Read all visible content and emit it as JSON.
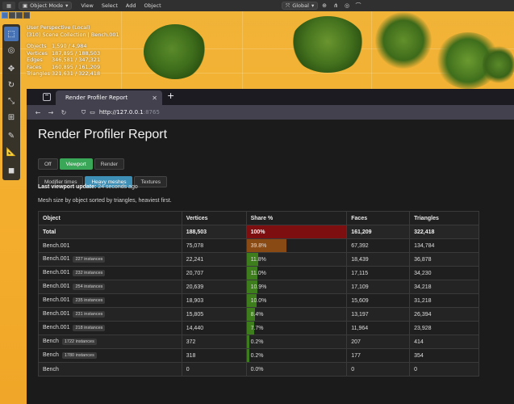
{
  "blender": {
    "mode_label": "Object Mode",
    "menus": [
      "View",
      "Select",
      "Add",
      "Object"
    ],
    "transform_orientation": "Global",
    "overlay": {
      "view_name": "User Perspective (Local)",
      "collection": "(310) Scene Collection | Bench.001",
      "stats": [
        {
          "label": "Objects",
          "value": "1,590 / 4,984"
        },
        {
          "label": "Vertices",
          "value": "187,895 / 188,503"
        },
        {
          "label": "Edges",
          "value": "346,581 / 347,321"
        },
        {
          "label": "Faces",
          "value": "160,895 / 161,209"
        },
        {
          "label": "Triangles",
          "value": "321,631 / 322,418"
        }
      ]
    }
  },
  "browser": {
    "tab_title": "Render Profiler Report",
    "url_host": "http://127.0.0.1",
    "url_rest": ":8765"
  },
  "page": {
    "title": "Render Profiler Report",
    "mode_buttons": [
      "Off",
      "Viewport",
      "Render"
    ],
    "view_buttons": [
      "Modifier times",
      "Heavy meshes",
      "Textures"
    ],
    "last_update_label": "Last viewport update:",
    "last_update_value": "24 seconds ago",
    "description": "Mesh size by object sorted by triangles, heaviest first."
  },
  "table": {
    "headers": [
      "Object",
      "Vertices",
      "Share %",
      "Faces",
      "Triangles"
    ],
    "total": {
      "object": "Total",
      "vertices": "188,503",
      "share": "100%",
      "share_value": 100,
      "faces": "161,209",
      "triangles": "322,418"
    },
    "rows": [
      {
        "object": "Bench.001",
        "badge": "",
        "vertices": "75,078",
        "share": "39.8%",
        "share_value": 39.8,
        "faces": "67,392",
        "triangles": "134,784"
      },
      {
        "object": "Bench.001",
        "badge": "227 instances",
        "vertices": "22,241",
        "share": "11.8%",
        "share_value": 11.8,
        "faces": "18,439",
        "triangles": "36,878"
      },
      {
        "object": "Bench.001",
        "badge": "232 instances",
        "vertices": "20,707",
        "share": "11.0%",
        "share_value": 11.0,
        "faces": "17,115",
        "triangles": "34,230"
      },
      {
        "object": "Bench.001",
        "badge": "254 instances",
        "vertices": "20,639",
        "share": "10.9%",
        "share_value": 10.9,
        "faces": "17,109",
        "triangles": "34,218"
      },
      {
        "object": "Bench.001",
        "badge": "235 instances",
        "vertices": "18,903",
        "share": "10.0%",
        "share_value": 10.0,
        "faces": "15,609",
        "triangles": "31,218"
      },
      {
        "object": "Bench.001",
        "badge": "231 instances",
        "vertices": "15,805",
        "share": "8.4%",
        "share_value": 8.4,
        "faces": "13,197",
        "triangles": "26,394"
      },
      {
        "object": "Bench.001",
        "badge": "218 instances",
        "vertices": "14,440",
        "share": "7.7%",
        "share_value": 7.7,
        "faces": "11,964",
        "triangles": "23,928"
      },
      {
        "object": "Bench",
        "badge": "1722 instances",
        "vertices": "372",
        "share": "0.2%",
        "share_value": 0.2,
        "faces": "207",
        "triangles": "414"
      },
      {
        "object": "Bench",
        "badge": "1780 instances",
        "vertices": "318",
        "share": "0.2%",
        "share_value": 0.2,
        "faces": "177",
        "triangles": "354"
      },
      {
        "object": "Bench",
        "badge": "",
        "vertices": "0",
        "share": "0.0%",
        "share_value": 0.0,
        "faces": "0",
        "triangles": "0"
      }
    ]
  },
  "colors": {
    "total_bar": "#7d0f10",
    "orange_bar": "#8a4a14",
    "green_bar": "#3e7d1c",
    "viewport_btn": "#3aa657",
    "heavy_btn": "#3d8fb5"
  }
}
